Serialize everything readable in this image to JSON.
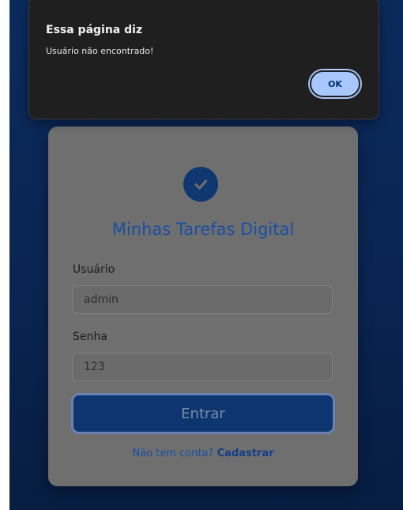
{
  "dialog": {
    "title": "Essa página diz",
    "message": "Usuário não encontrado!",
    "ok_label": "OK"
  },
  "app": {
    "title": "Minhas Tarefas Digital",
    "logo_icon": "check-circle-icon"
  },
  "form": {
    "username_label": "Usuário",
    "username_value": "admin",
    "password_label": "Senha",
    "password_value": "123",
    "submit_label": "Entrar",
    "signup_prompt": "Não tem conta?",
    "signup_link": "Cadastrar"
  },
  "colors": {
    "background": "#0a2552",
    "accent": "#1a4fa3",
    "dialog_bg": "#1f1f1f",
    "ok_button": "#a8c7fa"
  }
}
